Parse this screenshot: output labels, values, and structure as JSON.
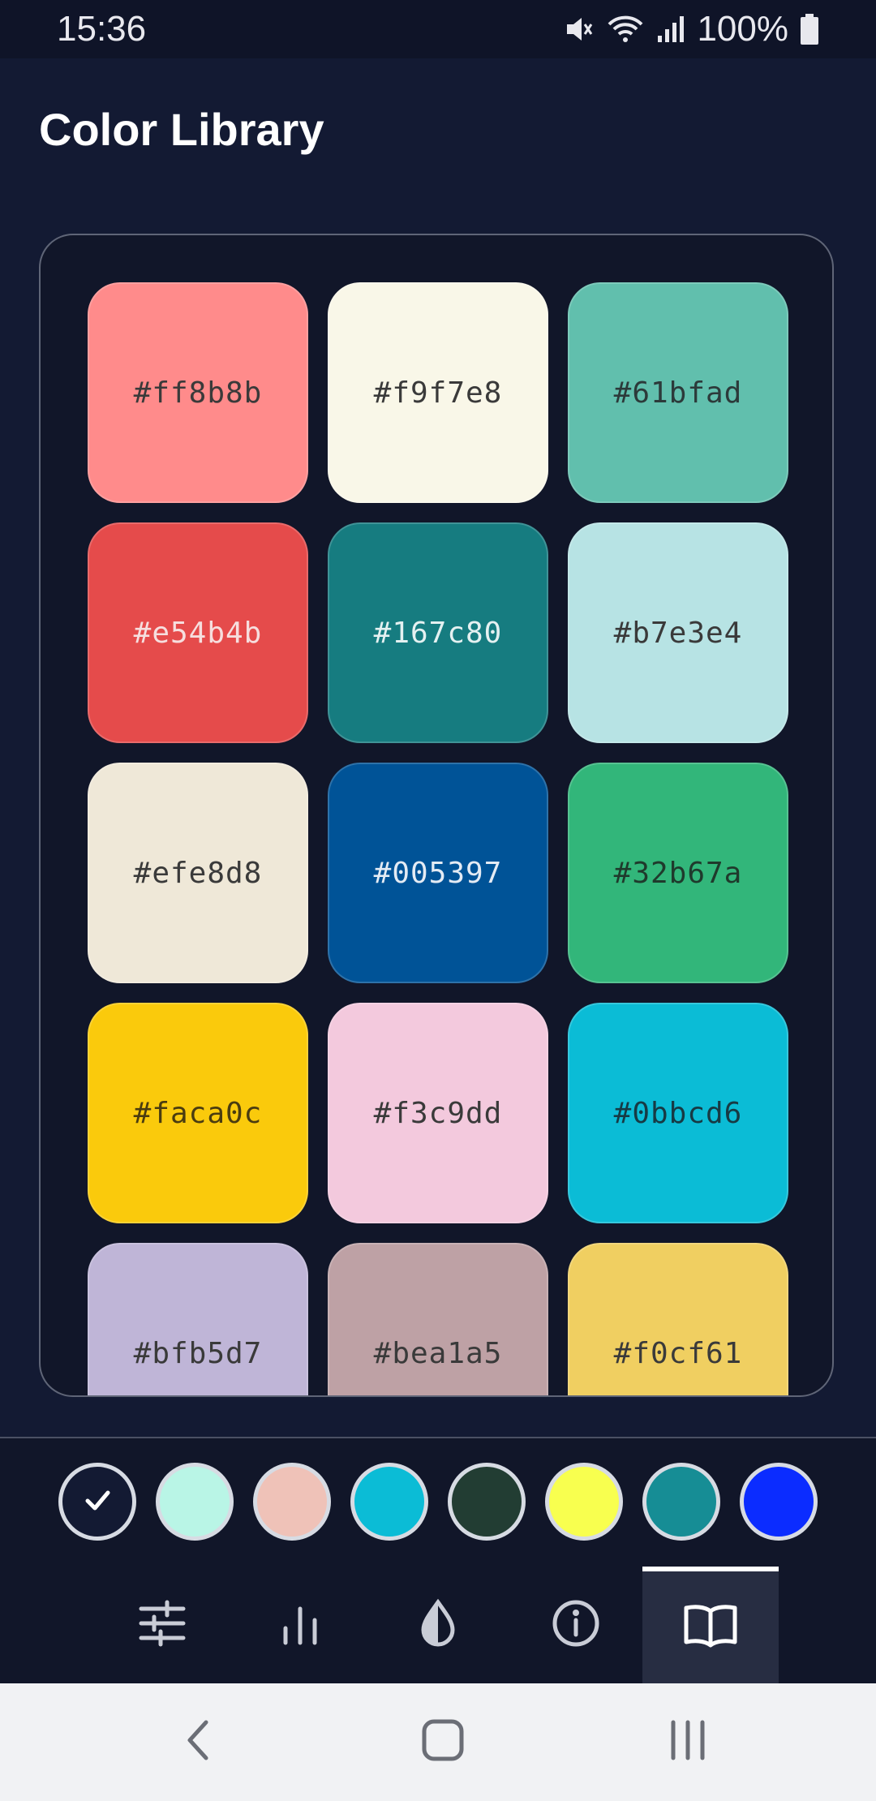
{
  "status_bar": {
    "time": "15:36",
    "battery": "100%",
    "icons": [
      "mute-icon",
      "wifi-icon",
      "signal-icon",
      "battery-icon"
    ]
  },
  "header": {
    "title": "Color Library"
  },
  "library": {
    "swatches": [
      {
        "hex": "#ff8b8b",
        "color": "#ff8b8b",
        "text_color": "#3a3a3a"
      },
      {
        "hex": "#f9f7e8",
        "color": "#f9f7e8",
        "text_color": "#3a3a3a"
      },
      {
        "hex": "#61bfad",
        "color": "#61bfad",
        "text_color": "#2c3a3a"
      },
      {
        "hex": "#e54b4b",
        "color": "#e54b4b",
        "text_color": "#f6dede"
      },
      {
        "hex": "#167c80",
        "color": "#167c80",
        "text_color": "#e4f1f1"
      },
      {
        "hex": "#b7e3e4",
        "color": "#b7e3e4",
        "text_color": "#3a3a3a"
      },
      {
        "hex": "#efe8d8",
        "color": "#efe8d8",
        "text_color": "#3a3a3a"
      },
      {
        "hex": "#005397",
        "color": "#005397",
        "text_color": "#e4ebf4"
      },
      {
        "hex": "#32b67a",
        "color": "#32b67a",
        "text_color": "#1f3a2c"
      },
      {
        "hex": "#faca0c",
        "color": "#faca0c",
        "text_color": "#4a3c10"
      },
      {
        "hex": "#f3c9dd",
        "color": "#f3c9dd",
        "text_color": "#3a3a3a"
      },
      {
        "hex": "#0bbcd6",
        "color": "#0bbcd6",
        "text_color": "#173a44"
      },
      {
        "hex": "#bfb5d7",
        "color": "#bfb5d7",
        "text_color": "#3a3a3a"
      },
      {
        "hex": "#bea1a5",
        "color": "#bea1a5",
        "text_color": "#3a3a3a"
      },
      {
        "hex": "#f0cf61",
        "color": "#f0cf61",
        "text_color": "#3a3a3a"
      }
    ]
  },
  "palette": {
    "chips": [
      {
        "color": "#131a33",
        "icon": "check-icon",
        "selected": true
      },
      {
        "color": "#b9f5e6",
        "selected": false
      },
      {
        "color": "#efc2b8",
        "selected": false
      },
      {
        "color": "#0bbcd6",
        "selected": false
      },
      {
        "color": "#223d33",
        "selected": false
      },
      {
        "color": "#f8ff4f",
        "selected": false
      },
      {
        "color": "#168d95",
        "selected": false
      },
      {
        "color": "#0b2cff",
        "selected": false
      }
    ]
  },
  "tabs": [
    {
      "icon": "sliders-icon",
      "active": false
    },
    {
      "icon": "bar-chart-icon",
      "active": false
    },
    {
      "icon": "contrast-drop-icon",
      "active": false
    },
    {
      "icon": "info-icon",
      "active": false
    },
    {
      "icon": "book-icon",
      "active": true
    }
  ],
  "nav": {
    "icons": [
      "back-icon",
      "home-icon",
      "recents-icon"
    ]
  }
}
